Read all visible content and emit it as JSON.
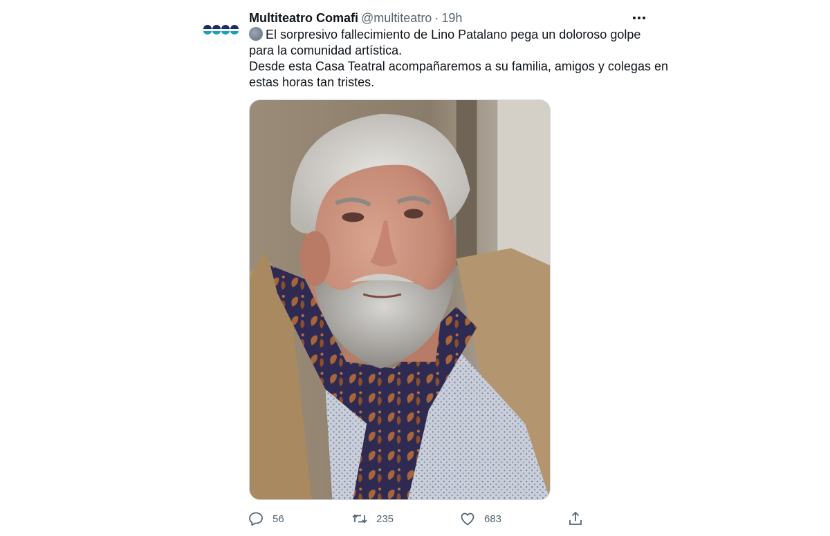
{
  "tweet": {
    "display_name": "Multiteatro Comafi",
    "handle": "@multiteatro",
    "separator": "·",
    "time": "19h",
    "text_lines": [
      "El sorpresivo fallecimiento de Lino Patalano pega un doloroso golpe",
      "para la comunidad artística.",
      "Desde esta Casa Teatral acompañaremos a su familia, amigos y colegas en",
      "estas horas tan tristes."
    ],
    "emoji": "grey-circle-emoji",
    "avatar_icon": "multiteatro-logo-icon",
    "more_icon": "more-dots-icon",
    "media_icon": "photo-of-gray-bearded-man-with-paisley-scarf"
  },
  "stats": {
    "replies": "56",
    "retweets": "235",
    "likes": "683"
  },
  "icons": {
    "reply": "reply-icon",
    "retweet": "retweet-icon",
    "like": "heart-icon",
    "share": "share-icon"
  },
  "colors": {
    "text": "#0f1419",
    "secondary": "#536471",
    "logo_navy": "#1a2a6c",
    "logo_teal": "#1aa3b5",
    "border": "#cfd9de"
  }
}
